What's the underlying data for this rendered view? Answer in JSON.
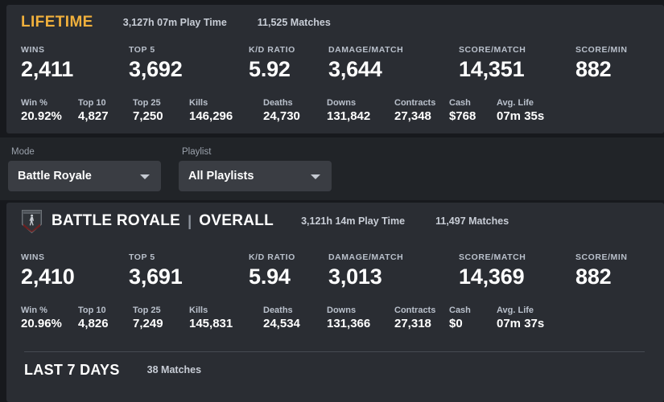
{
  "lifetime": {
    "title": "LIFETIME",
    "play_time": "3,127h 07m Play Time",
    "matches": "11,525 Matches",
    "primary": [
      {
        "label": "WINS",
        "value": "2,411"
      },
      {
        "label": "TOP 5",
        "value": "3,692"
      },
      {
        "label": "K/D RATIO",
        "value": "5.92"
      },
      {
        "label": "DAMAGE/MATCH",
        "value": "3,644"
      },
      {
        "label": "SCORE/MATCH",
        "value": "14,351"
      },
      {
        "label": "SCORE/MIN",
        "value": "882"
      }
    ],
    "secondary": [
      {
        "label": "Win %",
        "value": "20.92%"
      },
      {
        "label": "Top 10",
        "value": "4,827"
      },
      {
        "label": "Top 25",
        "value": "7,250"
      },
      {
        "label": "Kills",
        "value": "146,296"
      },
      {
        "label": "Deaths",
        "value": "24,730"
      },
      {
        "label": "Downs",
        "value": "131,842"
      },
      {
        "label": "Contracts",
        "value": "27,348"
      },
      {
        "label": "Cash",
        "value": "$768"
      },
      {
        "label": "Avg. Life",
        "value": "07m 35s"
      }
    ]
  },
  "filters": {
    "mode": {
      "label": "Mode",
      "value": "Battle Royale",
      "icon": "chevron-down-icon"
    },
    "playlist": {
      "label": "Playlist",
      "value": "All Playlists",
      "icon": "chevron-down-icon"
    }
  },
  "battle_royale": {
    "icon": "battle-royale-shield-icon",
    "title": "BATTLE ROYALE",
    "separator": "|",
    "subtitle": "OVERALL",
    "play_time": "3,121h 14m Play Time",
    "matches": "11,497 Matches",
    "primary": [
      {
        "label": "WINS",
        "value": "2,410"
      },
      {
        "label": "TOP 5",
        "value": "3,691"
      },
      {
        "label": "K/D RATIO",
        "value": "5.94"
      },
      {
        "label": "DAMAGE/MATCH",
        "value": "3,013"
      },
      {
        "label": "SCORE/MATCH",
        "value": "14,369"
      },
      {
        "label": "SCORE/MIN",
        "value": "882"
      }
    ],
    "secondary": [
      {
        "label": "Win %",
        "value": "20.96%"
      },
      {
        "label": "Top 10",
        "value": "4,826"
      },
      {
        "label": "Top 25",
        "value": "7,249"
      },
      {
        "label": "Kills",
        "value": "145,831"
      },
      {
        "label": "Deaths",
        "value": "24,534"
      },
      {
        "label": "Downs",
        "value": "131,366"
      },
      {
        "label": "Contracts",
        "value": "27,318"
      },
      {
        "label": "Cash",
        "value": "$0"
      },
      {
        "label": "Avg. Life",
        "value": "07m 37s"
      }
    ]
  },
  "last_seven_days": {
    "title": "LAST 7 DAYS",
    "matches": "38 Matches"
  },
  "colors": {
    "accent_gold": "#f0b03c",
    "panel_bg": "#2a2d33",
    "page_bg": "#17191d",
    "select_bg": "#3a3d43",
    "label_text": "#b9c0cb",
    "value_text": "#ffffff"
  }
}
